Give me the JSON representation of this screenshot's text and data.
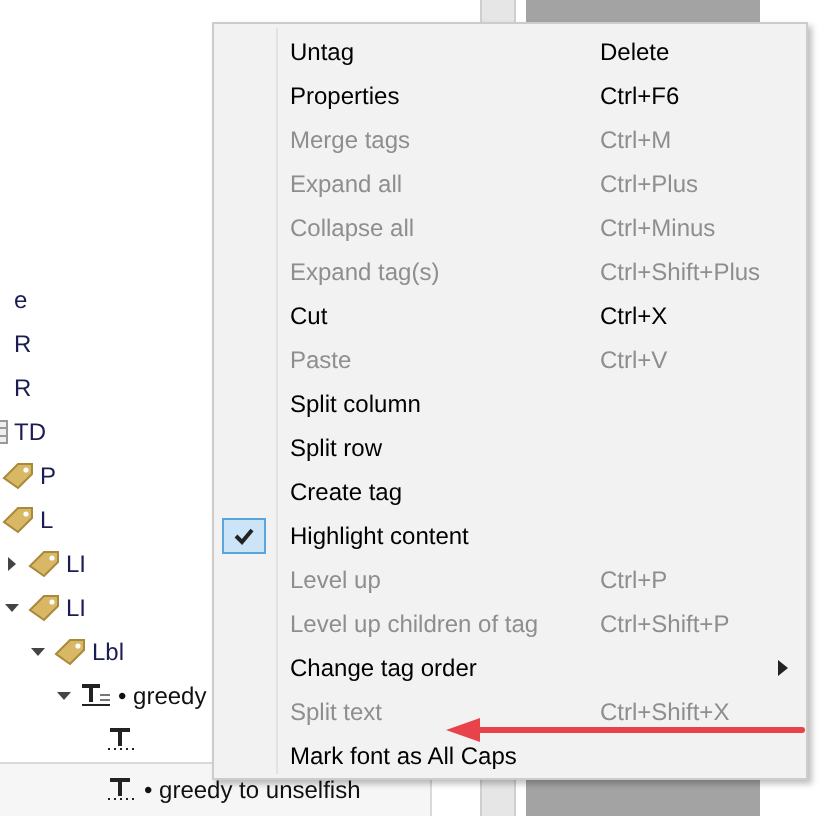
{
  "tree": [
    {
      "label": "e"
    },
    {
      "label": "R"
    },
    {
      "label": "R"
    },
    {
      "label": "TD",
      "kind": "table",
      "children": [
        {
          "label": "P",
          "kind": "tag"
        },
        {
          "label": "L",
          "kind": "tag",
          "children": [
            {
              "label": "LI",
              "kind": "tag",
              "expanded": false
            },
            {
              "label": "LI",
              "kind": "tag",
              "expanded": true,
              "children": [
                {
                  "label": "Lbl",
                  "kind": "tag",
                  "expanded": true,
                  "children": [
                    {
                      "label": "• greedy",
                      "kind": "paragraph",
                      "expanded": true,
                      "children": [
                        {
                          "kind": "text",
                          "selected": false
                        },
                        {
                          "label": "• greedy to unselfish",
                          "kind": "text",
                          "selected": true
                        }
                      ]
                    }
                  ]
                }
              ]
            }
          ]
        }
      ]
    }
  ],
  "context_menu": {
    "items": [
      {
        "kind": "command",
        "label": "Untag",
        "shortcut": "Delete",
        "disabled": false,
        "checked": false
      },
      {
        "kind": "command",
        "label": "Properties",
        "shortcut": "Ctrl+F6",
        "disabled": false,
        "checked": false
      },
      {
        "kind": "command",
        "label": "Merge tags",
        "shortcut": "Ctrl+M",
        "disabled": true,
        "checked": false
      },
      {
        "kind": "command",
        "label": "Expand all",
        "shortcut": "Ctrl+Plus",
        "disabled": true,
        "checked": false
      },
      {
        "kind": "command",
        "label": "Collapse all",
        "shortcut": "Ctrl+Minus",
        "disabled": true,
        "checked": false
      },
      {
        "kind": "command",
        "label": "Expand tag(s)",
        "shortcut": "Ctrl+Shift+Plus",
        "disabled": true,
        "checked": false
      },
      {
        "kind": "command",
        "label": "Cut",
        "shortcut": "Ctrl+X",
        "disabled": false,
        "checked": false
      },
      {
        "kind": "command",
        "label": "Paste",
        "shortcut": "Ctrl+V",
        "disabled": true,
        "checked": false
      },
      {
        "kind": "command",
        "label": "Split column",
        "disabled": false,
        "checked": false
      },
      {
        "kind": "command",
        "label": "Split row",
        "disabled": false,
        "checked": false
      },
      {
        "kind": "command",
        "label": "Create tag",
        "disabled": false,
        "checked": false
      },
      {
        "kind": "command",
        "label": "Highlight content",
        "disabled": false,
        "checked": true
      },
      {
        "kind": "command",
        "label": "Level up",
        "shortcut": "Ctrl+P",
        "disabled": true,
        "checked": false
      },
      {
        "kind": "command",
        "label": "Level up children of tag",
        "shortcut": "Ctrl+Shift+P",
        "disabled": true,
        "checked": false
      },
      {
        "kind": "submenu",
        "label": "Change tag order",
        "disabled": false,
        "checked": false
      },
      {
        "kind": "command",
        "label": "Split text",
        "shortcut": "Ctrl+Shift+X",
        "disabled": true,
        "checked": false,
        "annotated": true
      },
      {
        "kind": "command",
        "label": "Mark font as All Caps",
        "disabled": false,
        "checked": false
      }
    ]
  }
}
